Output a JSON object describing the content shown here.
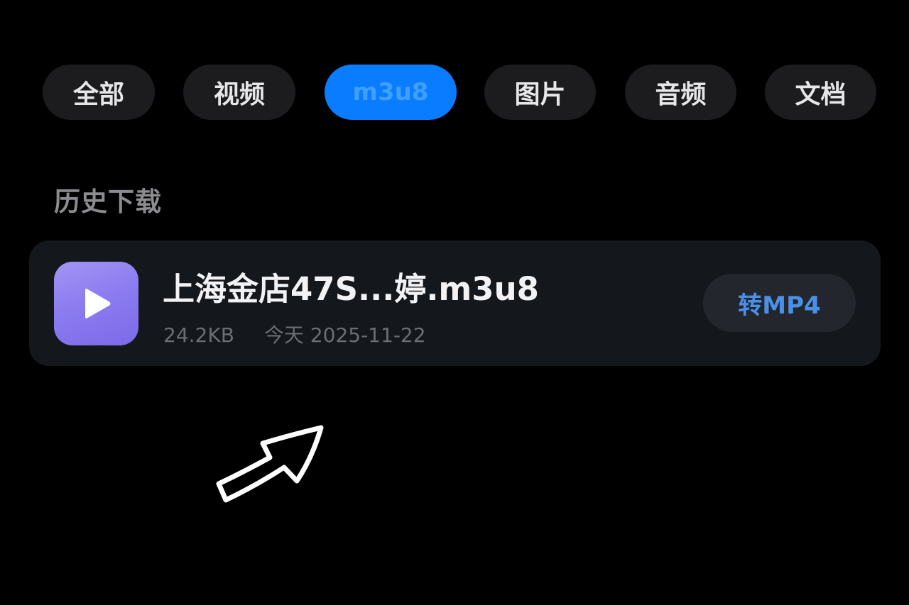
{
  "tabs": [
    {
      "label": "全部",
      "active": false
    },
    {
      "label": "视频",
      "active": false
    },
    {
      "label": "m3u8",
      "active": true
    },
    {
      "label": "图片",
      "active": false
    },
    {
      "label": "音频",
      "active": false
    },
    {
      "label": "文档",
      "active": false
    }
  ],
  "section": {
    "title": "历史下载"
  },
  "file": {
    "name": "上海金店47S...婷.m3u8",
    "size": "24.2KB",
    "date": "今天 2025-11-22",
    "icon": "play-icon",
    "convert_label": "转MP4"
  },
  "colors": {
    "background": "#000000",
    "accent": "#0a7cff",
    "tab_bg": "#1c1c1e",
    "card_bg": "#14171c",
    "thumb": "#8c7cf0",
    "convert_text": "#4a90e8"
  },
  "annotation": {
    "icon": "hand-drawn-arrow-icon"
  }
}
